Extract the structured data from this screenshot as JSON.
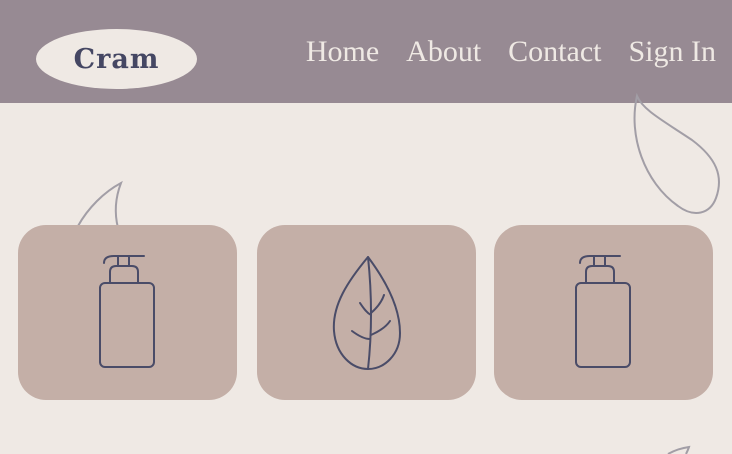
{
  "header": {
    "logo_text": "Cram",
    "nav": [
      {
        "label": "Home"
      },
      {
        "label": "About"
      },
      {
        "label": "Contact"
      },
      {
        "label": "Sign In"
      }
    ]
  },
  "cards": [
    {
      "icon": "pump-bottle-icon"
    },
    {
      "icon": "leaf-icon"
    },
    {
      "icon": "pump-bottle-icon"
    }
  ],
  "colors": {
    "header_bg": "#978A93",
    "page_bg": "#EFE9E4",
    "card_bg": "#C4AFA7",
    "icon_stroke": "#4A4C68",
    "accent_text": "#454763"
  }
}
